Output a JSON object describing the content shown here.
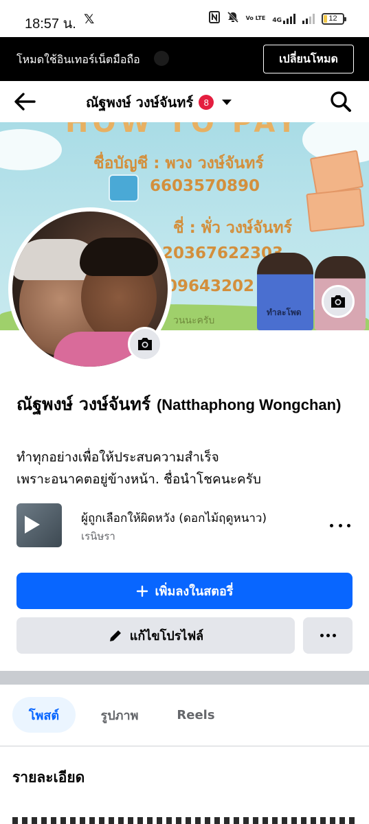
{
  "status_bar": {
    "time": "18:57 น.",
    "x_icon": "x-logo-icon",
    "icons": [
      "nfc-icon",
      "mute-icon",
      "volte-icon",
      "signal-4g-icon",
      "signal-icon"
    ],
    "volte_label": "Vo LTE",
    "network_label": "4G",
    "battery_level": "12"
  },
  "mode_banner": {
    "text": "โหมดใช้อินเทอร์เน็ตมือถือ",
    "button_label": "เปลี่ยนโหมด"
  },
  "nav": {
    "back_icon": "arrow-left-icon",
    "title": "ณัฐพงษ์ วงษ์จันทร์",
    "badge_count": "8",
    "caret_icon": "caret-down-icon",
    "search_icon": "search-icon"
  },
  "cover": {
    "heading": "HOW TO PAY",
    "account1_label": "ชื่อบัญชี : พวง วงษ์จันทร์",
    "account1_number": "6603570890",
    "account2_label": "ชี่ : พั่ว วงษ์จันทร์",
    "account2_number": "20367622303",
    "account3_number": "09643202",
    "footer_text": "วนนะครับ",
    "shirt_text": "ทำละโพด",
    "camera_icon": "camera-icon"
  },
  "profile": {
    "name_thai": "ณัฐพงษ์ วงษ์จันทร์",
    "name_latin": "(Natthaphong Wongchan)",
    "bio_line1": "ทำทุกอย่างเพื่อให้ประสบความสำเร็จ",
    "bio_line2": "เพราะอนาคตอยู่ข้างหน้า. ชื่อนำโชคนะครับ",
    "camera_icon": "camera-icon"
  },
  "music": {
    "title": "ผู้ถูกเลือกให้ผิดหวัง (ดอกไม้ฤดูหนาว)",
    "artist": "เรนิษรา",
    "play_icon": "play-icon",
    "more_icon": "more-horizontal-icon"
  },
  "actions": {
    "add_story_label": "เพิ่มลงในสตอรี่",
    "add_story_icon": "plus-icon",
    "edit_profile_label": "แก้ไขโปรไฟล์",
    "edit_icon": "pencil-icon",
    "more_icon": "more-horizontal-icon"
  },
  "tabs": [
    {
      "label": "โพสต์",
      "active": true
    },
    {
      "label": "รูปภาพ",
      "active": false
    },
    {
      "label": "Reels",
      "active": false
    }
  ],
  "details": {
    "title": "รายละเอียด"
  },
  "colors": {
    "primary": "#0866ff",
    "badge": "#e41e3f",
    "secondary_button": "#e4e6eb",
    "tab_active_bg": "#ebf5ff"
  }
}
